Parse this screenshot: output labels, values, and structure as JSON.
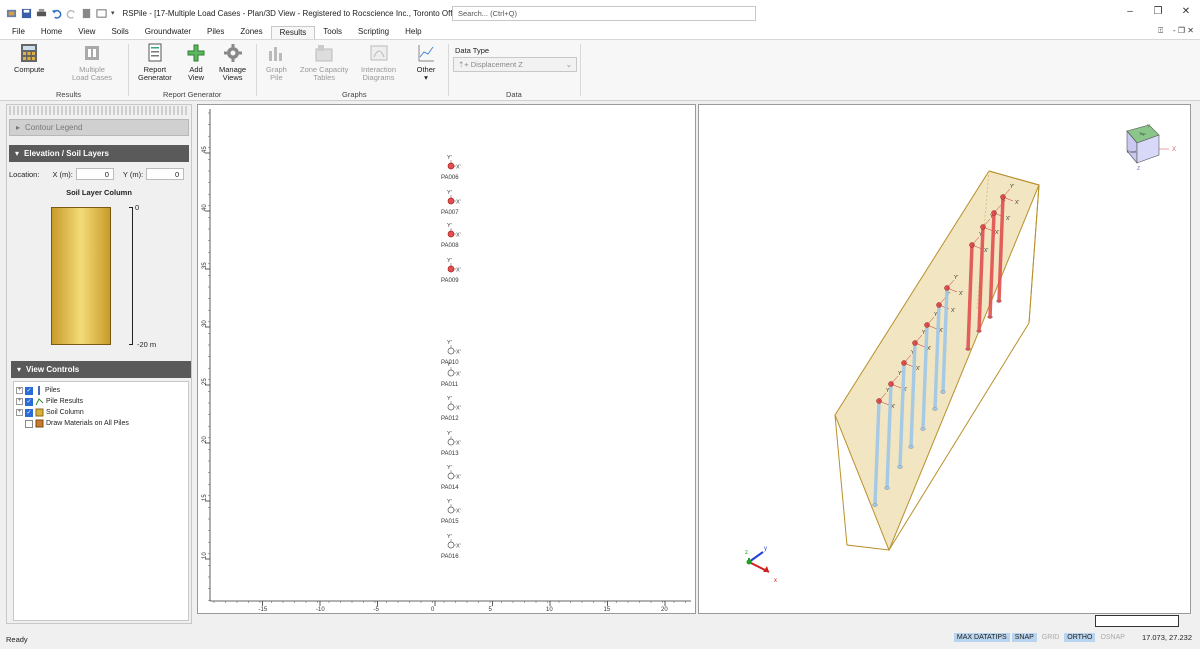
{
  "window": {
    "title": "RSPile - [17-Multiple Load Cases - Plan/3D View - Registered to Rocscience Inc., Toronto Office]",
    "search_placeholder": "Search... (Ctrl+Q)",
    "controls": [
      "–",
      "❐",
      "✕"
    ]
  },
  "menu": {
    "tabs": [
      "File",
      "Home",
      "View",
      "Soils",
      "Groundwater",
      "Piles",
      "Zones",
      "Results",
      "Tools",
      "Scripting",
      "Help"
    ],
    "active": "Results",
    "right_icons": [
      "⍐",
      "- ❐ ✕"
    ]
  },
  "ribbon": {
    "buttons": {
      "compute": "Compute",
      "multiple_load_cases": "Multiple\nLoad Cases",
      "report_generator": "Report\nGenerator",
      "add_view": "Add\nView",
      "manage_views": "Manage\nViews",
      "graph_pile": "Graph\nPile",
      "zone_capacity": "Zone Capacity\nTables",
      "interaction_diagrams": "Interaction\nDiagrams",
      "other": "Other"
    },
    "groups": {
      "results": "Results",
      "report_generator": "Report Generator",
      "graphs": "Graphs",
      "data": "Data"
    },
    "data_type_label": "Data Type",
    "data_type_value": "Displacement Z",
    "data_type_prefix": "⇡+"
  },
  "left_panel": {
    "contour_legend": "Contour Legend",
    "elevation_header": "Elevation / Soil Layers",
    "location_label": "Location:",
    "x_label": "X (m):",
    "x_value": "0",
    "y_label": "Y (m):",
    "y_value": "0",
    "soil_column_title": "Soil Layer Column",
    "soil_top": "0",
    "soil_bottom": "-20 m",
    "view_controls_header": "View Controls",
    "tree": [
      {
        "label": "Piles",
        "checked": true
      },
      {
        "label": "Pile Results",
        "checked": true
      },
      {
        "label": "Soil Column",
        "checked": true
      },
      {
        "label": "Draw Materials on All Piles",
        "checked": false
      }
    ]
  },
  "plan_view": {
    "x_ticks": [
      "-15",
      "-10",
      "-5",
      "0",
      "5",
      "10",
      "15",
      "20"
    ],
    "y_ticks": [
      "45",
      "40",
      "35",
      "30",
      "25",
      "20",
      "15",
      "10"
    ],
    "axis_y_label": "Y'",
    "axis_x_label": "X'",
    "piles": [
      "PA006",
      "PA007",
      "PA008",
      "PA009",
      "PA010",
      "PA011",
      "PA012",
      "PA013",
      "PA014",
      "PA015",
      "PA016"
    ]
  },
  "view3d": {
    "cube_faces": {
      "top": "Top",
      "front": "Front"
    },
    "cube_axes": {
      "x": "X",
      "y": "Y",
      "z": "Z"
    },
    "triad": {
      "x": "x",
      "y": "y",
      "z": "z"
    },
    "pile_axis_x": "X'",
    "pile_axis_y": "Y'"
  },
  "statusbar": {
    "ready": "Ready",
    "toggles": [
      {
        "label": "MAX DATATIPS",
        "on": true
      },
      {
        "label": "SNAP",
        "on": true
      },
      {
        "label": "GRID",
        "on": false
      },
      {
        "label": "ORTHO",
        "on": true
      },
      {
        "label": "OSNAP",
        "on": false
      }
    ],
    "coords": "17.073, 27.232"
  },
  "colors": {
    "pile_red": "#e05050",
    "pile_blue": "#9ec8e8",
    "soil_gold": "#e8cc60",
    "box_edge": "#b8902a"
  }
}
